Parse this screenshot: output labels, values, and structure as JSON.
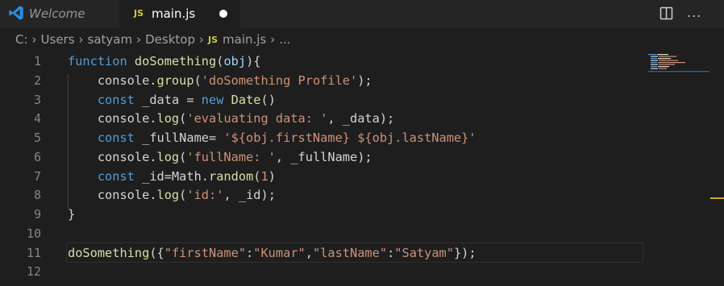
{
  "tabs": {
    "welcome_label": "Welcome",
    "active_label": "main.js",
    "js_badge": "JS"
  },
  "toolbar": {
    "more": "..."
  },
  "breadcrumb": {
    "items": [
      "C:",
      "Users",
      "satyam",
      "Desktop",
      "main.js",
      "..."
    ],
    "js_badge": "JS"
  },
  "colors": {
    "keyword": "#569cd6",
    "function": "#dcdcaa",
    "string": "#ce9178",
    "variable": "#9cdcfe",
    "text": "#d4d4d4",
    "js_badge": "#cbcb41"
  },
  "editor": {
    "lines": [
      {
        "n": "1",
        "tokens": [
          [
            "kw",
            "function"
          ],
          [
            "pun",
            " "
          ],
          [
            "fn",
            "doSomething"
          ],
          [
            "pun",
            "("
          ],
          [
            "par",
            "obj"
          ],
          [
            "pun",
            "){"
          ]
        ]
      },
      {
        "n": "2",
        "tokens": [
          [
            "pun",
            "    console."
          ],
          [
            "fn",
            "group"
          ],
          [
            "pun",
            "("
          ],
          [
            "str",
            "'doSomething Profile'"
          ],
          [
            "pun",
            ");"
          ]
        ]
      },
      {
        "n": "3",
        "tokens": [
          [
            "pun",
            "    "
          ],
          [
            "kw",
            "const"
          ],
          [
            "pun",
            " _data = "
          ],
          [
            "kw",
            "new"
          ],
          [
            "pun",
            " "
          ],
          [
            "fn",
            "Date"
          ],
          [
            "pun",
            "()"
          ]
        ]
      },
      {
        "n": "4",
        "tokens": [
          [
            "pun",
            "    console."
          ],
          [
            "fn",
            "log"
          ],
          [
            "pun",
            "("
          ],
          [
            "str",
            "'evaluating data: '"
          ],
          [
            "pun",
            ", _data);"
          ]
        ]
      },
      {
        "n": "5",
        "tokens": [
          [
            "pun",
            "    "
          ],
          [
            "kw",
            "const"
          ],
          [
            "pun",
            " _fullName= "
          ],
          [
            "str",
            "'${obj.firstName} ${obj.lastName}'"
          ]
        ]
      },
      {
        "n": "6",
        "tokens": [
          [
            "pun",
            "    console."
          ],
          [
            "fn",
            "log"
          ],
          [
            "pun",
            "("
          ],
          [
            "str",
            "'fullName: '"
          ],
          [
            "pun",
            ", _fullName);"
          ]
        ]
      },
      {
        "n": "7",
        "tokens": [
          [
            "pun",
            "    "
          ],
          [
            "kw",
            "const"
          ],
          [
            "pun",
            " _id=Math."
          ],
          [
            "fn",
            "random"
          ],
          [
            "pun",
            "("
          ],
          [
            "str",
            "1"
          ],
          [
            "pun",
            ")"
          ]
        ]
      },
      {
        "n": "8",
        "tokens": [
          [
            "pun",
            "    console."
          ],
          [
            "fn",
            "log"
          ],
          [
            "pun",
            "("
          ],
          [
            "str",
            "'id:'"
          ],
          [
            "pun",
            ", _id);"
          ]
        ]
      },
      {
        "n": "9",
        "tokens": [
          [
            "pun",
            "}"
          ]
        ]
      },
      {
        "n": "10",
        "tokens": []
      },
      {
        "n": "11",
        "tokens": [
          [
            "fn",
            "doSomething"
          ],
          [
            "pun",
            "({"
          ],
          [
            "str",
            "\"firstName\""
          ],
          [
            "pun",
            ":"
          ],
          [
            "str",
            "\"Kumar\""
          ],
          [
            "pun",
            ","
          ],
          [
            "str",
            "\"lastName\""
          ],
          [
            "pun",
            ":"
          ],
          [
            "str",
            "\"Satyam\""
          ],
          [
            "pun",
            "});"
          ]
        ]
      },
      {
        "n": "12",
        "tokens": []
      }
    ]
  }
}
